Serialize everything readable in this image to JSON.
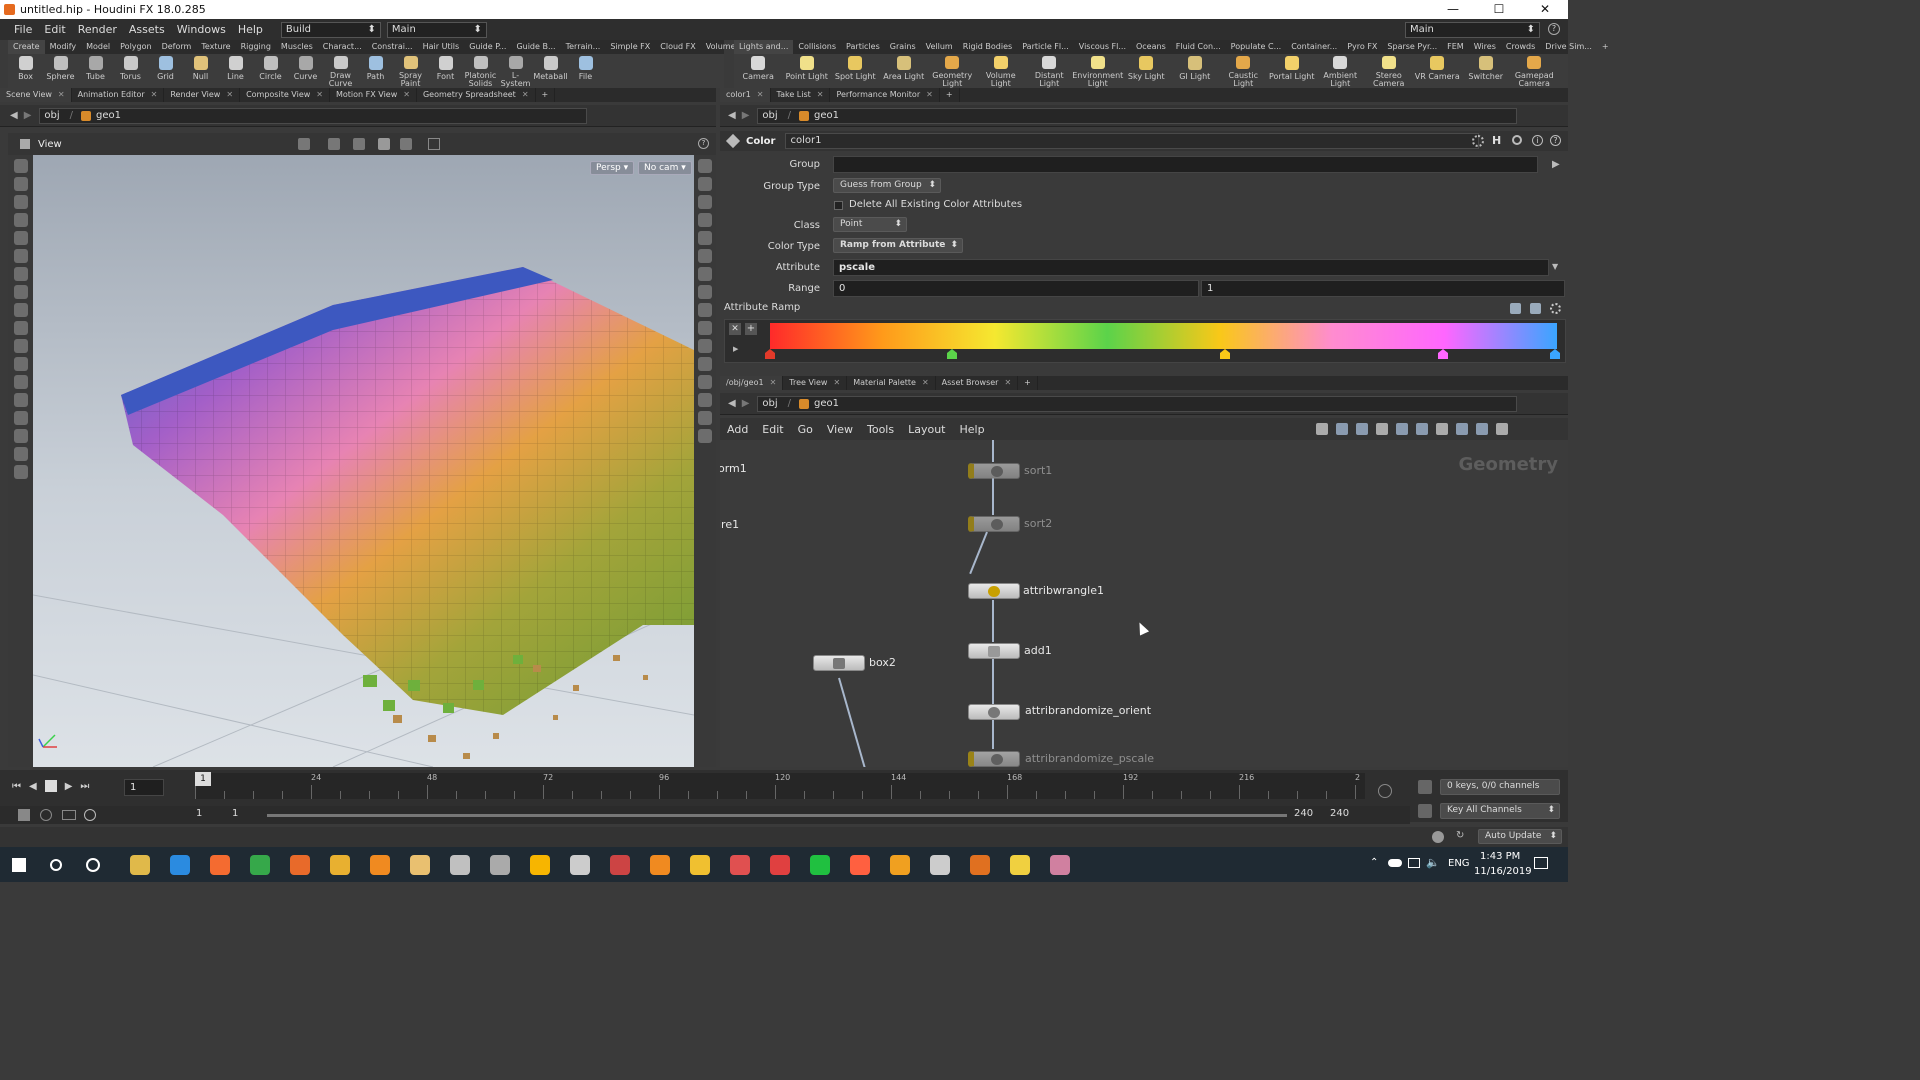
{
  "window": {
    "title": "untitled.hip - Houdini FX 18.0.285",
    "min": "—",
    "max": "☐",
    "close": "✕"
  },
  "menu": {
    "items": [
      "File",
      "Edit",
      "Render",
      "Assets",
      "Windows",
      "Help"
    ],
    "build": "Build",
    "main": "Main",
    "desktop": "Main"
  },
  "shelf_left": {
    "tabs": [
      "Create",
      "Modify",
      "Model",
      "Polygon",
      "Deform",
      "Texture",
      "Rigging",
      "Muscles",
      "Charact...",
      "Constrai...",
      "Hair Utils",
      "Guide P...",
      "Guide B...",
      "Terrain...",
      "Simple FX",
      "Cloud FX",
      "Volume"
    ],
    "tools": [
      "Box",
      "Sphere",
      "Tube",
      "Torus",
      "Grid",
      "Null",
      "Line",
      "Circle",
      "Curve",
      "Draw Curve",
      "Path",
      "Spray Paint",
      "Font",
      "Platonic Solids",
      "L-System",
      "Metaball",
      "File"
    ]
  },
  "shelf_right": {
    "tabs": [
      "Lights and...",
      "Collisions",
      "Particles",
      "Grains",
      "Vellum",
      "Rigid Bodies",
      "Particle Fl...",
      "Viscous Fl...",
      "Oceans",
      "Fluid Con...",
      "Populate C...",
      "Container...",
      "Pyro FX",
      "Sparse Pyr...",
      "FEM",
      "Wires",
      "Crowds",
      "Drive Sim..."
    ],
    "tools": [
      "Camera",
      "Point Light",
      "Spot Light",
      "Area Light",
      "Geometry Light",
      "Volume Light",
      "Distant Light",
      "Environment Light",
      "Sky Light",
      "GI Light",
      "Caustic Light",
      "Portal Light",
      "Ambient Light",
      "Stereo Camera",
      "VR Camera",
      "Switcher",
      "Gamepad Camera"
    ]
  },
  "left_panes": {
    "tabs": [
      "Scene View",
      "Animation Editor",
      "Render View",
      "Composite View",
      "Motion FX View",
      "Geometry Spreadsheet"
    ],
    "path": [
      "obj",
      "geo1"
    ],
    "view_label": "View",
    "persp": "Persp ▾",
    "cam": "No cam ▾"
  },
  "params": {
    "tabs": [
      "color1",
      "Take List",
      "Performance Monitor"
    ],
    "path": [
      "obj",
      "geo1"
    ],
    "node_type": "Color",
    "node_name": "color1",
    "group_label": "Group",
    "group_value": "",
    "group_type_label": "Group Type",
    "group_type_value": "Guess from Group",
    "delete_label": "Delete All Existing Color Attributes",
    "class_label": "Class",
    "class_value": "Point",
    "color_type_label": "Color Type",
    "color_type_value": "Ramp from Attribute",
    "attribute_label": "Attribute",
    "attribute_value": "pscale",
    "range_label": "Range",
    "range_min": "0",
    "range_max": "1",
    "ramp_label": "Attribute Ramp"
  },
  "network": {
    "tabs": [
      "/obj/geo1",
      "Tree View",
      "Material Palette",
      "Asset Browser"
    ],
    "path": [
      "obj",
      "geo1"
    ],
    "menu": [
      "Add",
      "Edit",
      "Go",
      "View",
      "Tools",
      "Layout",
      "Help"
    ],
    "context": "Geometry",
    "partial_left": [
      "orm1",
      "ire1"
    ],
    "nodes": [
      "sort1",
      "sort2",
      "attribwrangle1",
      "add1",
      "box2",
      "attribrandomize_orient",
      "attribrandomize_pscale"
    ]
  },
  "timeline": {
    "frame": "1",
    "start_frame": "1",
    "ticks": [
      "1",
      "24",
      "48",
      "72",
      "96",
      "120",
      "144",
      "168",
      "192",
      "216",
      "2"
    ],
    "range_start": "1",
    "range_start2": "1",
    "range_end": "240",
    "range_end2": "240",
    "keys": "0 keys, 0/0 channels",
    "key_all": "Key All Channels",
    "auto_update": "Auto Update"
  },
  "taskbar": {
    "lang": "ENG",
    "time": "1:43 PM",
    "date": "11/16/2019"
  },
  "colors": {
    "ramp_stops": [
      "#ff2a2a",
      "#ff9a1a",
      "#f5e830",
      "#5bd34a",
      "#f9c818",
      "#ff8ccf",
      "#ff66ff",
      "#3aa5ff"
    ],
    "node_flag": "#d9b400",
    "wire": "#a8b7cc"
  }
}
